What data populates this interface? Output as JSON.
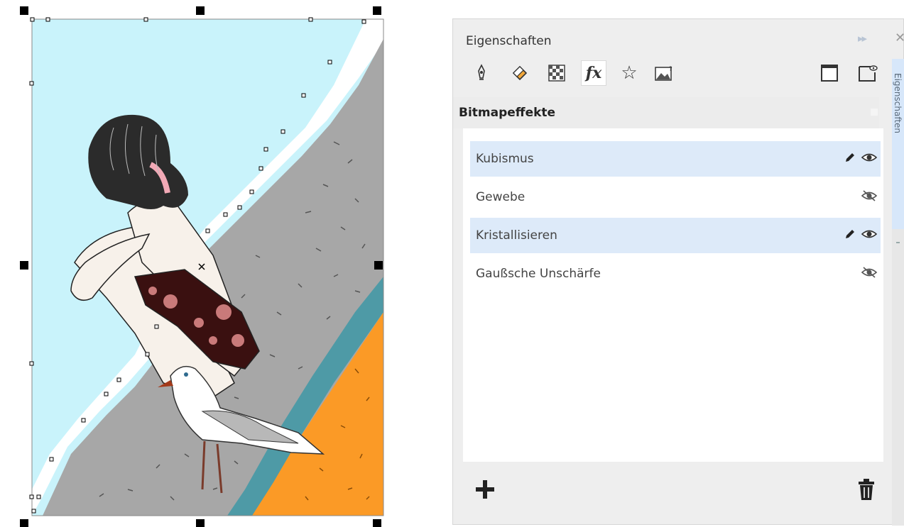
{
  "docker": {
    "title": "Eigenschaften",
    "controls": "▸▸",
    "close": "✕",
    "tabs": [
      {
        "name": "outline-pen-icon",
        "selected": false
      },
      {
        "name": "fill-icon",
        "selected": false
      },
      {
        "name": "transparency-icon",
        "selected": false
      },
      {
        "name": "effects-fx-icon",
        "label": "fx",
        "selected": true
      },
      {
        "name": "star-icon",
        "label": "☆",
        "selected": false
      },
      {
        "name": "bitmap-image-icon",
        "selected": false
      }
    ],
    "right_tabs": [
      {
        "name": "frame-icon"
      },
      {
        "name": "page-preview-icon"
      }
    ],
    "section_title": "Bitmapeffekte",
    "effects": [
      {
        "label": "Kubismus",
        "selected": true,
        "visible": true,
        "editable": true
      },
      {
        "label": "Gewebe",
        "selected": false,
        "visible": false,
        "editable": false
      },
      {
        "label": "Kristallisieren",
        "selected": true,
        "visible": true,
        "editable": true
      },
      {
        "label": "Gaußsche Unschärfe",
        "selected": false,
        "visible": false,
        "editable": false
      }
    ],
    "add_label": "+",
    "side_tab_label": "Eigenschaften"
  },
  "colors": {
    "sky": "#c9f3fb",
    "rock": "#a7a7a7",
    "sand": "#fb9a26",
    "teal": "#4e9aa6",
    "selection_blue": "#ddeaf9",
    "hair": "#2b2b2b",
    "skin": "#f7f1ea",
    "swimsuit": "#3a1010"
  },
  "icons": {
    "edit": "pencil-icon",
    "visible": "eye-icon",
    "hidden": "eye-hidden-icon",
    "delete": "trash-icon",
    "add": "plus-icon"
  }
}
